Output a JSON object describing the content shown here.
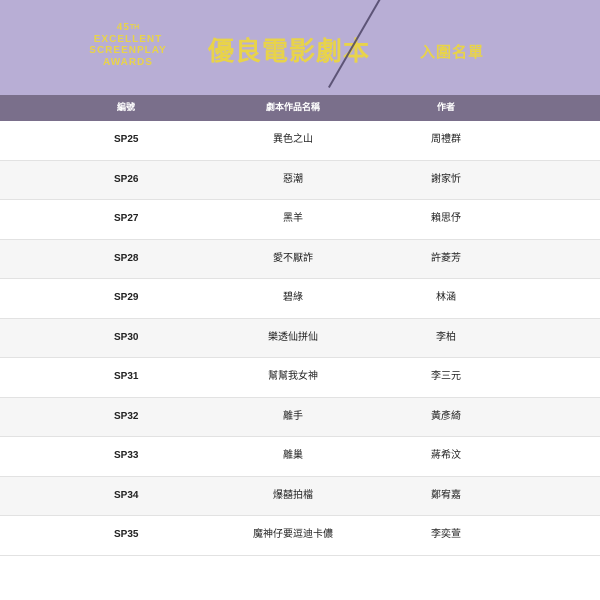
{
  "header": {
    "awards_line1": "45",
    "awards_line1_sup": "TH",
    "awards_line2": "EXCELLENT",
    "awards_line3": "SCREENPLAY",
    "awards_line4": "AWARDS",
    "title": "優良電影劇本",
    "subtitle": "入圍名單"
  },
  "colors": {
    "header_bg": "#b8aed5",
    "accent_yellow": "#e8d34a",
    "table_header_bg": "#7a6f8b",
    "row_alt_bg": "#f6f6f6"
  },
  "table": {
    "columns": [
      "編號",
      "劇本作品名稱",
      "作者"
    ],
    "rows": [
      {
        "code": "SP25",
        "title": "異色之山",
        "author": "周禮群"
      },
      {
        "code": "SP26",
        "title": "惡潮",
        "author": "謝家忻"
      },
      {
        "code": "SP27",
        "title": "黑羊",
        "author": "賴思伃"
      },
      {
        "code": "SP28",
        "title": "愛不厭詐",
        "author": "許菱芳"
      },
      {
        "code": "SP29",
        "title": "碧綠",
        "author": "林涵"
      },
      {
        "code": "SP30",
        "title": "樂透仙拼仙",
        "author": "李柏"
      },
      {
        "code": "SP31",
        "title": "幫幫我女神",
        "author": "李三元"
      },
      {
        "code": "SP32",
        "title": "離手",
        "author": "黃彥綺"
      },
      {
        "code": "SP33",
        "title": "離巢",
        "author": "蔣希汶"
      },
      {
        "code": "SP34",
        "title": "爆囍拍檔",
        "author": "鄭宥嘉"
      },
      {
        "code": "SP35",
        "title": "魔神仔要逗迪卡儂",
        "author": "李奕萱"
      }
    ]
  }
}
